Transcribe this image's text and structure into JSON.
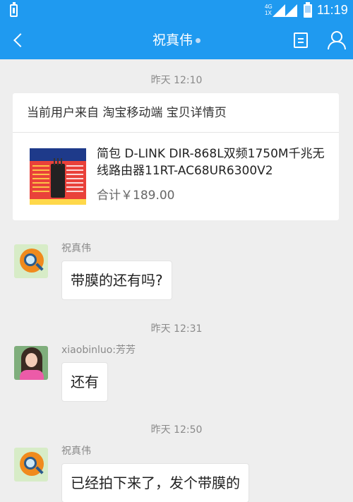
{
  "status_bar": {
    "network_label": "4G\n1X",
    "time": "11:19"
  },
  "header": {
    "title": "祝真伟",
    "back_icon": "chevron-left-icon",
    "menu_icon": "document-list-icon",
    "profile_icon": "person-icon"
  },
  "messages": {
    "timestamp_1": "昨天 12:10",
    "product_card": {
      "source": "当前用户来自 淘宝移动端 宝贝详情页",
      "title": "简包 D-LINK DIR-868L双频1750M千兆无线路由器11RT-AC68UR6300V2",
      "price": "合计￥189.00"
    },
    "msg_1": {
      "sender": "祝真伟",
      "text": "带膜的还有吗?"
    },
    "timestamp_2": "昨天 12:31",
    "msg_2": {
      "sender": "xiaobinluo:芳芳",
      "text": "还有"
    },
    "timestamp_3": "昨天 12:50",
    "msg_3": {
      "sender": "祝真伟",
      "text": "已经拍下来了，发个带膜的"
    }
  },
  "colors": {
    "header_blue": "#1f9af0",
    "chat_background": "#eeeeee",
    "bubble": "#ffffff"
  }
}
